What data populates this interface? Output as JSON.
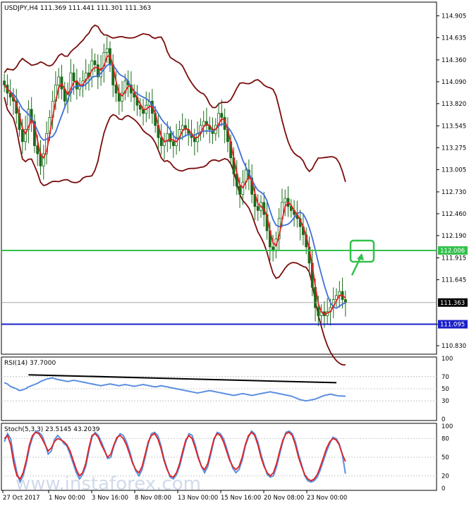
{
  "chart_data": [
    {
      "type": "candlestick",
      "title": "USDJPY,H4  111.369 111.441 111.301 111.363",
      "ylim": [
        110.76,
        115.03
      ],
      "y_ticks": [
        "114.905",
        "114.635",
        "114.360",
        "114.090",
        "113.820",
        "113.545",
        "113.275",
        "113.005",
        "112.730",
        "112.460",
        "112.190",
        "111.915",
        "111.645",
        "111.095",
        "110.830"
      ],
      "x_ticks": [
        "27 Oct 2017",
        "1 Nov 00:00",
        "3 Nov 16:00",
        "8 Nov 08:00",
        "13 Nov 00:00",
        "15 Nov 16:00",
        "20 Nov 08:00",
        "23 Nov 00:00"
      ],
      "ohlc_close": [
        114.05,
        113.95,
        113.9,
        113.85,
        113.7,
        113.5,
        113.35,
        113.5,
        113.75,
        113.6,
        113.3,
        113.2,
        113.05,
        113.2,
        113.45,
        113.65,
        113.85,
        114.05,
        114.15,
        114.0,
        113.85,
        113.95,
        114.2,
        114.1,
        114.0,
        114.05,
        114.1,
        114.2,
        114.15,
        114.35,
        114.3,
        114.15,
        114.25,
        114.45,
        114.5,
        114.3,
        114.05,
        113.95,
        113.85,
        113.95,
        114.1,
        114.05,
        113.95,
        113.9,
        113.8,
        113.75,
        113.7,
        113.8,
        113.85,
        113.7,
        113.55,
        113.4,
        113.3,
        113.35,
        113.45,
        113.35,
        113.3,
        113.4,
        113.5,
        113.55,
        113.5,
        113.45,
        113.4,
        113.35,
        113.45,
        113.55,
        113.6,
        113.55,
        113.5,
        113.45,
        113.55,
        113.7,
        113.65,
        113.5,
        113.35,
        113.15,
        112.95,
        112.8,
        112.7,
        112.85,
        113.0,
        112.9,
        112.7,
        112.55,
        112.5,
        112.6,
        112.45,
        112.25,
        112.05,
        112.0,
        112.15,
        112.4,
        112.6,
        112.65,
        112.55,
        112.5,
        112.45,
        112.4,
        112.3,
        112.2,
        112.05,
        111.85,
        111.55,
        111.3,
        111.2,
        111.25,
        111.2,
        111.25,
        111.3,
        111.4,
        111.45,
        111.5,
        111.4,
        111.36
      ],
      "levels": [
        {
          "price": 112.006,
          "label": "112.006",
          "color": "#33c04c"
        },
        {
          "price": 111.095,
          "label": "111.095",
          "color": "#1a20c8"
        },
        {
          "price": 111.363,
          "label": "111.363",
          "color": "#000000"
        }
      ],
      "target_box": {
        "price": 112.006,
        "color": "#33c04c"
      },
      "colors": {
        "ma_fast": "#e02020",
        "ma_slow": "#3f6fd8",
        "bands": "#7a0c0c",
        "candles": "#1a6b1a"
      }
    },
    {
      "type": "line",
      "title": "RSI(14) 37.7000",
      "ylim": [
        0,
        100
      ],
      "y_ticks": [
        "100",
        "70",
        "50",
        "30",
        "0"
      ],
      "levels": [
        70,
        50,
        30
      ],
      "trendline": [
        [
          8,
          73
        ],
        [
          110,
          60
        ]
      ],
      "series": [
        {
          "values": [
            60,
            58,
            54,
            52,
            50,
            47,
            48,
            50,
            53,
            55,
            57,
            59,
            62,
            64,
            66,
            67,
            68,
            66,
            65,
            64,
            63,
            62,
            63,
            64,
            63,
            62,
            61,
            60,
            59,
            58,
            57,
            56,
            55,
            56,
            57,
            58,
            57,
            56,
            55,
            56,
            57,
            56,
            55,
            54,
            55,
            56,
            57,
            56,
            55,
            54,
            53,
            54,
            55,
            54,
            53,
            52,
            51,
            50,
            49,
            48,
            47,
            46,
            45,
            44,
            43,
            44,
            45,
            46,
            47,
            46,
            45,
            44,
            43,
            42,
            41,
            40,
            39,
            40,
            41,
            42,
            41,
            40,
            39,
            40,
            41,
            42,
            43,
            44,
            45,
            44,
            43,
            42,
            41,
            40,
            39,
            38,
            36,
            34,
            32,
            31,
            30,
            31,
            32,
            33,
            35,
            37,
            39,
            40,
            41,
            40,
            39,
            38,
            38,
            37.7
          ],
          "color": "#5b8ee0"
        }
      ]
    },
    {
      "type": "line",
      "title": "Stoch(5,3,3) 23.5145 43.2039",
      "ylim": [
        0,
        100
      ],
      "y_ticks": [
        "100",
        "80",
        "50",
        "20",
        "0"
      ],
      "levels": [
        80,
        50,
        20
      ],
      "series": [
        {
          "values": [
            80,
            85,
            70,
            40,
            20,
            15,
            25,
            45,
            70,
            85,
            90,
            88,
            80,
            70,
            60,
            65,
            75,
            80,
            78,
            75,
            70,
            60,
            45,
            30,
            20,
            25,
            40,
            65,
            85,
            88,
            82,
            70,
            60,
            50,
            55,
            70,
            82,
            85,
            80,
            70,
            55,
            40,
            30,
            25,
            35,
            55,
            75,
            85,
            88,
            80,
            65,
            45,
            30,
            20,
            18,
            25,
            40,
            60,
            78,
            85,
            80,
            65,
            48,
            35,
            30,
            40,
            60,
            80,
            88,
            85,
            75,
            60,
            45,
            35,
            30,
            35,
            50,
            70,
            85,
            90,
            85,
            70,
            50,
            35,
            25,
            20,
            25,
            40,
            60,
            78,
            88,
            90,
            85,
            70,
            50,
            35,
            22,
            15,
            12,
            15,
            22,
            35,
            50,
            65,
            75,
            80,
            78,
            70,
            55,
            43.2
          ],
          "color": "#e02020"
        },
        {
          "values": [
            75,
            88,
            80,
            50,
            25,
            10,
            20,
            40,
            65,
            82,
            92,
            90,
            85,
            72,
            55,
            60,
            78,
            85,
            80,
            72,
            68,
            55,
            40,
            25,
            15,
            22,
            35,
            60,
            82,
            90,
            85,
            75,
            62,
            48,
            50,
            68,
            80,
            88,
            85,
            75,
            60,
            42,
            28,
            20,
            30,
            50,
            72,
            88,
            90,
            85,
            70,
            48,
            32,
            18,
            15,
            22,
            35,
            55,
            75,
            88,
            85,
            70,
            50,
            35,
            25,
            35,
            55,
            78,
            90,
            88,
            80,
            65,
            48,
            32,
            25,
            30,
            45,
            68,
            82,
            92,
            88,
            75,
            55,
            38,
            22,
            18,
            20,
            35,
            55,
            75,
            90,
            92,
            88,
            75,
            55,
            38,
            20,
            12,
            10,
            12,
            18,
            30,
            45,
            60,
            72,
            82,
            80,
            72,
            55,
            23.5
          ],
          "color": "#5b8ee0"
        }
      ]
    }
  ],
  "watermark": "www.instaforex.com"
}
